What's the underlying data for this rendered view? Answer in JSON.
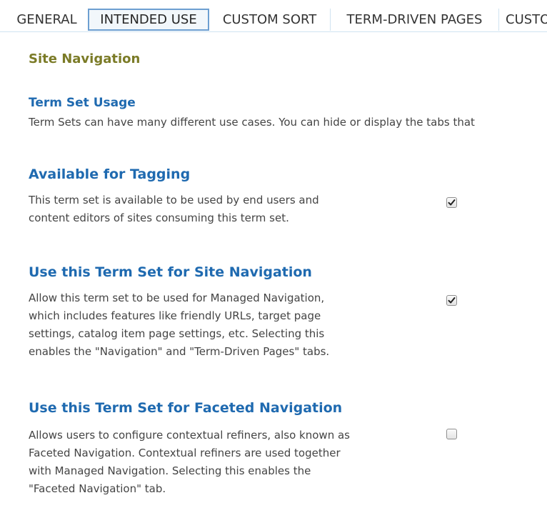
{
  "tabs": [
    {
      "label": "GENERAL",
      "active": false
    },
    {
      "label": "INTENDED USE",
      "active": true
    },
    {
      "label": "CUSTOM SORT",
      "active": false
    },
    {
      "label": "TERM-DRIVEN PAGES",
      "active": false
    },
    {
      "label": "CUSTOM PROPERTIES",
      "active": false
    }
  ],
  "site_navigation": {
    "title": "Site Navigation"
  },
  "term_set_usage": {
    "title": "Term Set Usage",
    "description": "Term Sets can have many different use cases. You can hide or display the tabs that"
  },
  "available_for_tagging": {
    "title": "Available for Tagging",
    "lines": [
      "This term set is available to be used by end users and",
      "content editors of sites consuming this term set."
    ],
    "checked": true
  },
  "site_navigation_usage": {
    "title": "Use this Term Set for Site Navigation",
    "lines": [
      "Allow this term set to be used for Managed Navigation,",
      "which includes features like friendly URLs, target page",
      "settings, catalog item page settings, etc. Selecting this",
      "enables the \"Navigation\" and \"Term-Driven Pages\" tabs."
    ],
    "checked": true
  },
  "faceted_navigation_usage": {
    "title": "Use this Term Set for Faceted Navigation",
    "lines": [
      "Allows users to configure contextual refiners, also known as",
      "Faceted Navigation. Contextual refiners are used together",
      "with Managed Navigation. Selecting this enables the",
      "\"Faceted Navigation\" tab."
    ],
    "checked": false
  }
}
